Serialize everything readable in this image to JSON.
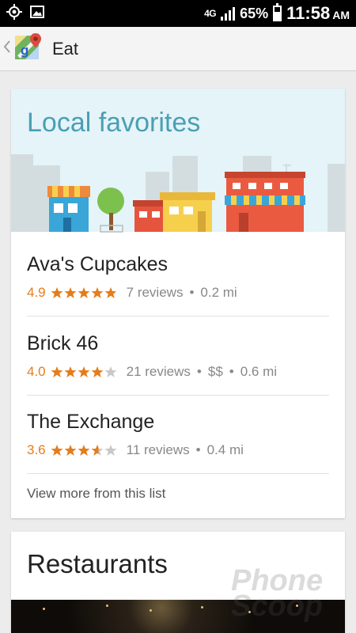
{
  "status_bar": {
    "network": "4G",
    "battery": "65%",
    "battery_level": 0.65,
    "time": "11:58",
    "ampm": "AM",
    "icons": [
      "location-crosshair-icon",
      "image-icon",
      "signal-icon",
      "battery-icon"
    ]
  },
  "app_bar": {
    "title": "Eat",
    "back_icon": "chevron-left-icon",
    "logo_icon": "google-maps-icon"
  },
  "favorites": {
    "title": "Local favorites",
    "items": [
      {
        "name": "Ava's Cupcakes",
        "rating": "4.9",
        "rating_value": 4.9,
        "reviews": "7 reviews",
        "price": "",
        "distance": "0.2 mi"
      },
      {
        "name": "Brick 46",
        "rating": "4.0",
        "rating_value": 4.0,
        "reviews": "21 reviews",
        "price": "$$",
        "distance": "0.6 mi"
      },
      {
        "name": "The Exchange",
        "rating": "3.6",
        "rating_value": 3.6,
        "reviews": "11 reviews",
        "price": "",
        "distance": "0.4 mi"
      }
    ],
    "view_more": "View more from this list"
  },
  "restaurants": {
    "title": "Restaurants"
  },
  "watermark": [
    "Phone",
    "Scoop"
  ],
  "colors": {
    "accent_title": "#4a9fb4",
    "rating": "#e47d1a",
    "star_empty": "#c8c8c8",
    "banner_bg": "#e4f4f8"
  }
}
